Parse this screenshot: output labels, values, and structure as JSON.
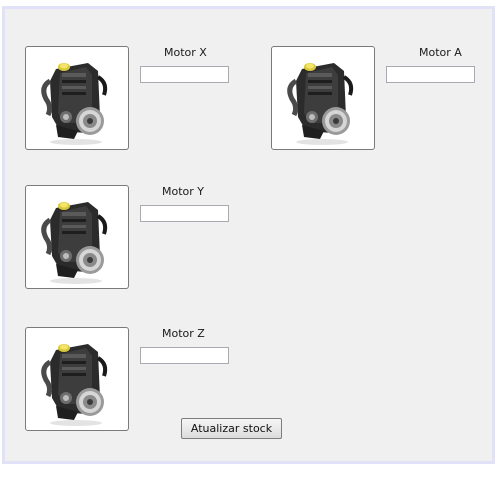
{
  "items": [
    {
      "name": "Motor X",
      "stock_value": "",
      "image_icon": "engine-image"
    },
    {
      "name": "Motor A",
      "stock_value": "",
      "image_icon": "engine-image"
    },
    {
      "name": "Motor Y",
      "stock_value": "",
      "image_icon": "engine-image"
    },
    {
      "name": "Motor Z",
      "stock_value": "",
      "image_icon": "engine-image"
    }
  ],
  "actions": {
    "update_stock_label": "Atualizar stock"
  },
  "colors": {
    "panel_background": "#f0f0f0",
    "window_border": "#e1e1f8"
  }
}
